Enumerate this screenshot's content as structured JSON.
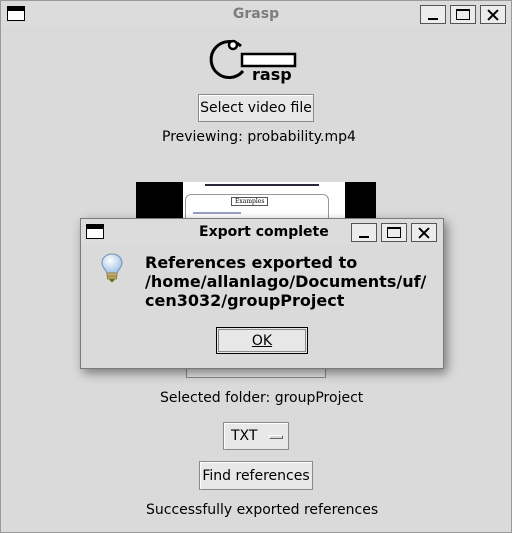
{
  "window": {
    "title": "Grasp"
  },
  "logo": {
    "text": "rasp"
  },
  "main": {
    "select_video_label": "Select video file",
    "previewing_text": "Previewing: probability.mp4",
    "preview_tag": "Examples",
    "selected_folder_text": "Selected folder: groupProject",
    "format_value": "TXT",
    "find_references_label": "Find references",
    "status_text": "Successfully exported references"
  },
  "dialog": {
    "title": "Export complete",
    "message_lines": [
      "References exported to",
      "/home/allanlago/Documents/uf/",
      "cen3032/groupProject"
    ],
    "ok_label": "OK",
    "icon": "lightbulb-icon"
  },
  "colors": {
    "background": "#dadada",
    "title_text": "#7d7d7d"
  }
}
